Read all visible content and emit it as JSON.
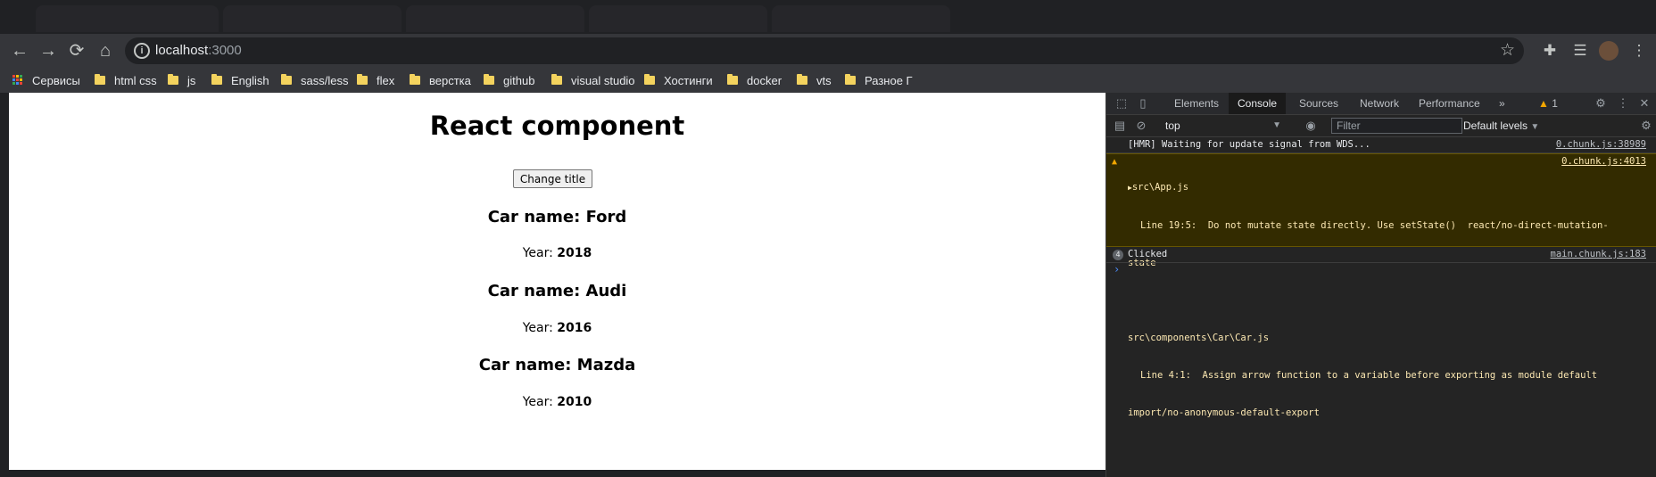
{
  "browser": {
    "url_host": "localhost",
    "url_port": ":3000"
  },
  "bookmarks": [
    {
      "label": "Сервисы",
      "icon": "apps-grid-icon"
    },
    {
      "label": "html css",
      "icon": "folder-icon"
    },
    {
      "label": "js",
      "icon": "folder-icon"
    },
    {
      "label": "English",
      "icon": "folder-icon"
    },
    {
      "label": "sass/less",
      "icon": "folder-icon"
    },
    {
      "label": "flex",
      "icon": "folder-icon"
    },
    {
      "label": "верстка",
      "icon": "folder-icon"
    },
    {
      "label": "github",
      "icon": "folder-icon"
    },
    {
      "label": "visual studio",
      "icon": "folder-icon"
    },
    {
      "label": "Хостинги",
      "icon": "folder-icon"
    },
    {
      "label": "docker",
      "icon": "folder-icon"
    },
    {
      "label": "vts",
      "icon": "folder-icon"
    },
    {
      "label": "Разное Г",
      "icon": "folder-icon"
    }
  ],
  "page": {
    "title": "React component",
    "button_label": "Change title",
    "year_prefix": "Year:",
    "cars": [
      {
        "name": "Car name: Ford",
        "year": "2018"
      },
      {
        "name": "Car name: Audi",
        "year": "2016"
      },
      {
        "name": "Car name: Mazda",
        "year": "2010"
      }
    ]
  },
  "devtools": {
    "tabs": [
      "Elements",
      "Console",
      "Sources",
      "Network",
      "Performance"
    ],
    "active_tab": "Console",
    "more_tabs": "»",
    "warnings_count": "1",
    "context": "top",
    "filter_placeholder": "Filter",
    "levels": "Default levels",
    "messages": {
      "hmr": {
        "text": "[HMR] Waiting for update signal from WDS...",
        "source": "0.chunk.js:38989"
      },
      "warning": {
        "file1": "src\\App.js",
        "line1": "Line 19:5:  Do not mutate state directly. Use setState()  react/no-direct-mutation-",
        "line1b": "state",
        "file2": "src\\components\\Car\\Car.js",
        "line2": "Line 4:1:  Assign arrow function to a variable before exporting as module default",
        "line2b": "import/no-anonymous-default-export",
        "source": "0.chunk.js:4013"
      },
      "log": {
        "count": "4",
        "text": "Clicked",
        "source": "main.chunk.js:183"
      }
    },
    "prompt": "›"
  },
  "colors": {
    "warning_bg": "#332b00",
    "warning_icon": "#f2a600",
    "prompt": "#4c8bf5",
    "folder": "#f4d35e"
  }
}
